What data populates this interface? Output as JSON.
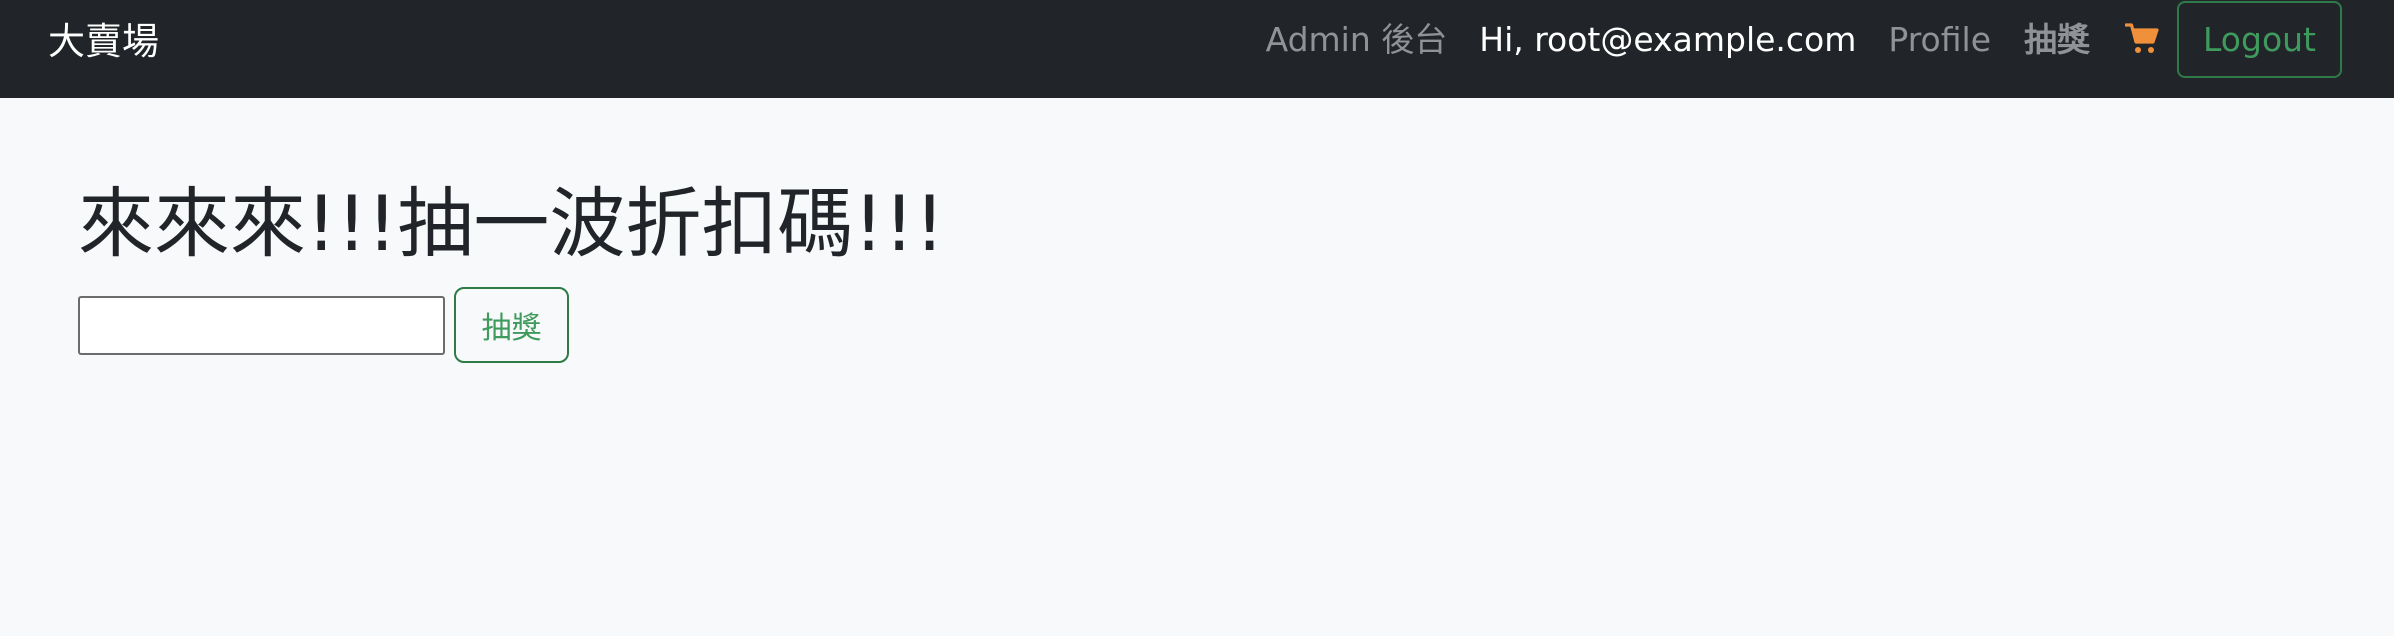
{
  "navbar": {
    "brand": "大賣場",
    "links": {
      "admin": "Admin 後台",
      "user_greeting": "Hi, root@example.com",
      "profile": "Profile",
      "lottery": "抽獎"
    },
    "cart_icon": "shopping-cart-icon",
    "logout_label": "Logout"
  },
  "main": {
    "headline": "來來來!!!抽一波折扣碼!!!",
    "code_input": {
      "value": "",
      "placeholder": ""
    },
    "draw_button_label": "抽獎"
  },
  "colors": {
    "navbar_bg": "#212529",
    "page_bg": "#f8f9fa",
    "success_outline": "#3f9a5e",
    "cart_accent": "#f0903a",
    "muted_link": "#8f9296"
  }
}
